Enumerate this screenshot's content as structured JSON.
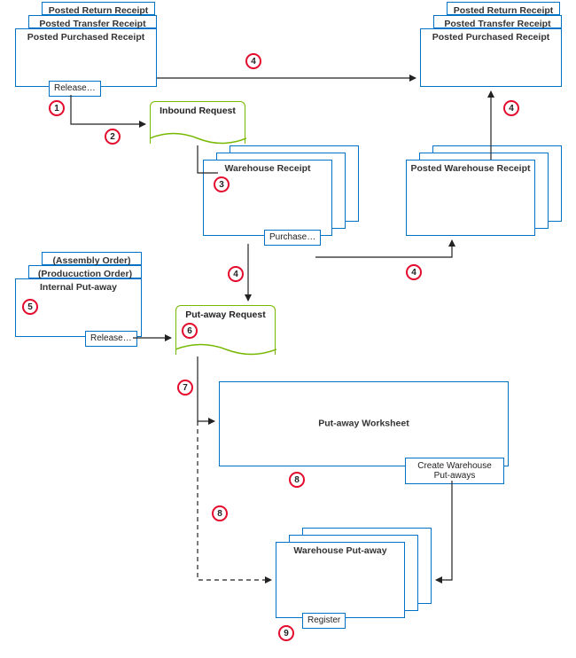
{
  "boxes": {
    "posted_return_receipt": "Posted Return  Receipt",
    "posted_transfer_receipt": "Posted Transfer Receipt",
    "posted_purchased_receipt": "Posted Purchased Receipt",
    "warehouse_receipt": "Warehouse Receipt",
    "posted_warehouse_receipt": "Posted Warehouse Receipt",
    "assembly_order": "(Assembly Order)",
    "production_order": "(Producuction Order)",
    "internal_putaway": "Internal Put-away",
    "inbound_request": "Inbound Request",
    "putaway_request": "Put-away Request",
    "putaway_worksheet": "Put-away Worksheet",
    "warehouse_putaway": "Warehouse Put-away"
  },
  "actions": {
    "release": "Release…",
    "purchase": "Purchase…",
    "create_wh_putaways": "Create Warehouse\nPut-aways",
    "register": "Register"
  },
  "badges": {
    "b1": "1",
    "b2": "2",
    "b3": "3",
    "b4": "4",
    "b5": "5",
    "b6": "6",
    "b7": "7",
    "b8": "8",
    "b9": "9"
  }
}
